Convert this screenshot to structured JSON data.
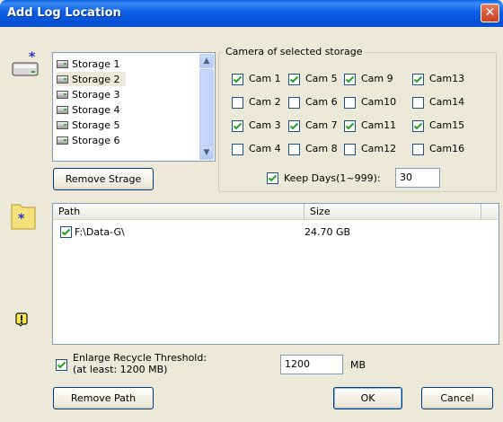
{
  "window": {
    "title": "Add Log Location",
    "close_glyph": "✕"
  },
  "storage": {
    "items": [
      {
        "label": "Storage 1",
        "selected": false
      },
      {
        "label": "Storage 2",
        "selected": true
      },
      {
        "label": "Storage 3",
        "selected": false
      },
      {
        "label": "Storage 4",
        "selected": false
      },
      {
        "label": "Storage 5",
        "selected": false
      },
      {
        "label": "Storage 6",
        "selected": false
      }
    ],
    "remove_button": "Remove Strage"
  },
  "camera_group": {
    "title": "Camera of selected storage",
    "cams": [
      {
        "label": "Cam 1",
        "checked": true
      },
      {
        "label": "Cam 5",
        "checked": true
      },
      {
        "label": "Cam 9",
        "checked": true
      },
      {
        "label": "Cam13",
        "checked": true
      },
      {
        "label": "Cam 2",
        "checked": false
      },
      {
        "label": "Cam 6",
        "checked": false
      },
      {
        "label": "Cam10",
        "checked": false
      },
      {
        "label": "Cam14",
        "checked": false
      },
      {
        "label": "Cam 3",
        "checked": true
      },
      {
        "label": "Cam 7",
        "checked": true
      },
      {
        "label": "Cam11",
        "checked": true
      },
      {
        "label": "Cam15",
        "checked": true
      },
      {
        "label": "Cam 4",
        "checked": false
      },
      {
        "label": "Cam 8",
        "checked": false
      },
      {
        "label": "Cam12",
        "checked": false
      },
      {
        "label": "Cam16",
        "checked": false
      }
    ],
    "keep_days": {
      "label": "Keep Days(1~999):",
      "checked": true,
      "value": "30"
    }
  },
  "paths": {
    "columns": [
      "Path",
      "Size"
    ],
    "rows": [
      {
        "path": "F:\\Data-G\\",
        "size": "24.70 GB",
        "checked": true
      }
    ]
  },
  "recycle": {
    "label_line1": "Enlarge Recycle Threshold:",
    "label_line2": "(at least: 1200 MB)",
    "checked": true,
    "value": "1200",
    "unit": "MB"
  },
  "buttons": {
    "remove_path": "Remove Path",
    "ok": "OK",
    "cancel": "Cancel"
  },
  "icons": {
    "storage": "hard-drive-new-icon",
    "folder": "folder-new-icon",
    "warning": "warning-icon",
    "drive_item": "drive-icon",
    "check": "checkmark-icon"
  },
  "colors": {
    "title_bar": "#0a5ee6",
    "close": "#c8401f",
    "dialog": "#ece9d8",
    "check": "#21a121"
  }
}
